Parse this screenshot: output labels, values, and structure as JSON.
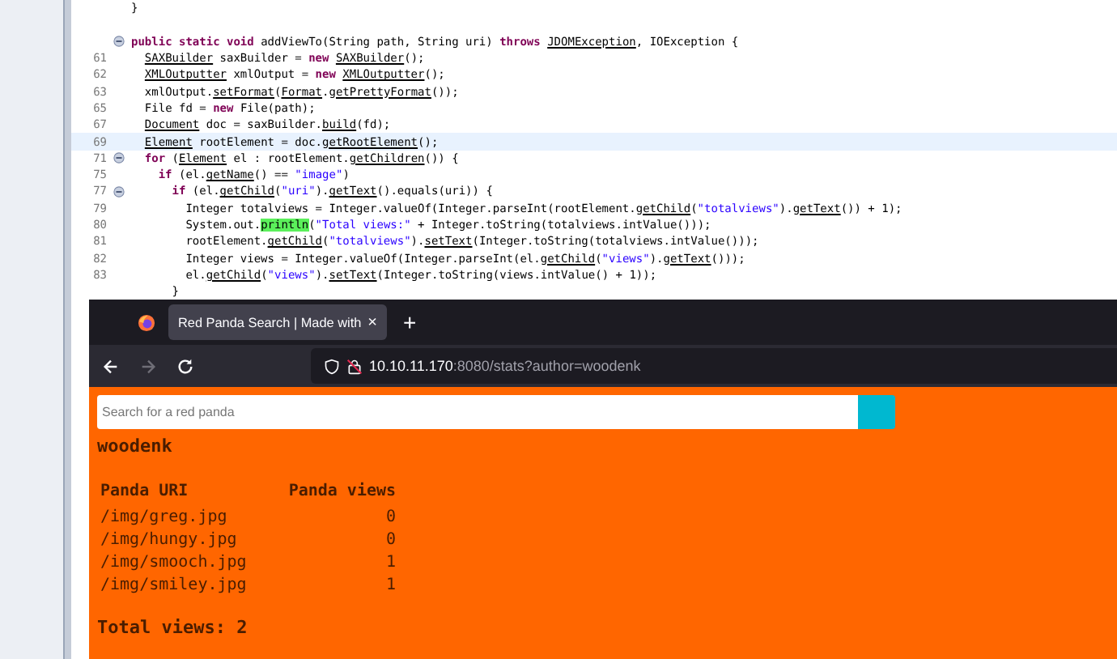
{
  "editor": {
    "lines": [
      {
        "tokens": [
          {
            "kind": "plain",
            "text": "}"
          }
        ]
      },
      {
        "fold": true,
        "blank_before": true,
        "tokens": [
          {
            "kind": "keyword",
            "text": "public static void"
          },
          {
            "kind": "plain",
            "text": " addViewTo(String path, String uri) "
          },
          {
            "kind": "keyword",
            "text": "throws "
          },
          {
            "kind": "ref",
            "text": "JDOMException"
          },
          {
            "kind": "plain",
            "text": ", IOException {"
          }
        ],
        "children": [
          {
            "number": "61",
            "tokens": [
              {
                "kind": "ref",
                "text": "SAXBuilder"
              },
              {
                "kind": "plain",
                "text": " saxBuilder = "
              },
              {
                "kind": "keyword",
                "text": "new "
              },
              {
                "kind": "ref",
                "text": "SAXBuilder"
              },
              {
                "kind": "plain",
                "text": "();"
              }
            ]
          },
          {
            "number": "62",
            "tokens": [
              {
                "kind": "ref",
                "text": "XMLOutputter"
              },
              {
                "kind": "plain",
                "text": " xmlOutput = "
              },
              {
                "kind": "keyword",
                "text": "new "
              },
              {
                "kind": "ref",
                "text": "XMLOutputter"
              },
              {
                "kind": "plain",
                "text": "();"
              }
            ]
          },
          {
            "number": "63",
            "tokens": [
              {
                "kind": "plain",
                "text": "xmlOutput."
              },
              {
                "kind": "ref",
                "text": "setFormat"
              },
              {
                "kind": "plain",
                "text": "("
              },
              {
                "kind": "ref",
                "text": "Format"
              },
              {
                "kind": "plain",
                "text": "."
              },
              {
                "kind": "ref",
                "text": "getPrettyFormat"
              },
              {
                "kind": "plain",
                "text": "());"
              }
            ]
          },
          {
            "number": "65",
            "tokens": [
              {
                "kind": "plain",
                "text": "File fd = "
              },
              {
                "kind": "keyword",
                "text": "new"
              },
              {
                "kind": "plain",
                "text": " File(path);"
              }
            ]
          },
          {
            "number": "67",
            "tokens": [
              {
                "kind": "ref",
                "text": "Document"
              },
              {
                "kind": "plain",
                "text": " doc = saxBuilder."
              },
              {
                "kind": "ref",
                "text": "build"
              },
              {
                "kind": "plain",
                "text": "(fd);"
              }
            ]
          },
          {
            "number": "69",
            "current": true,
            "tokens": [
              {
                "kind": "ref",
                "text": "Element"
              },
              {
                "kind": "plain",
                "text": " rootElement = doc."
              },
              {
                "kind": "ref",
                "text": "getRootElement"
              },
              {
                "kind": "plain",
                "text": "();"
              }
            ]
          },
          {
            "number": "71",
            "fold": true,
            "tokens": [
              {
                "kind": "keyword",
                "text": "for"
              },
              {
                "kind": "plain",
                "text": " ("
              },
              {
                "kind": "ref",
                "text": "Element"
              },
              {
                "kind": "plain",
                "text": " el : rootElement."
              },
              {
                "kind": "ref",
                "text": "getChildren"
              },
              {
                "kind": "plain",
                "text": "()) {"
              }
            ],
            "children": [
              {
                "number": "75",
                "tokens": [
                  {
                    "kind": "keyword",
                    "text": "if"
                  },
                  {
                    "kind": "plain",
                    "text": " (el."
                  },
                  {
                    "kind": "ref",
                    "text": "getName"
                  },
                  {
                    "kind": "plain",
                    "text": "() == "
                  },
                  {
                    "kind": "string",
                    "text": "\"image\""
                  },
                  {
                    "kind": "plain",
                    "text": ")"
                  }
                ],
                "children": [
                  {
                    "number": "77",
                    "fold": true,
                    "tokens": [
                      {
                        "kind": "keyword",
                        "text": "if"
                      },
                      {
                        "kind": "plain",
                        "text": " (el."
                      },
                      {
                        "kind": "ref",
                        "text": "getChild"
                      },
                      {
                        "kind": "plain",
                        "text": "("
                      },
                      {
                        "kind": "string",
                        "text": "\"uri\""
                      },
                      {
                        "kind": "plain",
                        "text": ")."
                      },
                      {
                        "kind": "ref",
                        "text": "getText"
                      },
                      {
                        "kind": "plain",
                        "text": "().equals(uri)) {"
                      }
                    ],
                    "children": [
                      {
                        "number": "79",
                        "tokens": [
                          {
                            "kind": "plain",
                            "text": "Integer totalviews = Integer.valueOf(Integer.parseInt(rootElement."
                          },
                          {
                            "kind": "ref",
                            "text": "getChild"
                          },
                          {
                            "kind": "plain",
                            "text": "("
                          },
                          {
                            "kind": "string",
                            "text": "\"totalviews\""
                          },
                          {
                            "kind": "plain",
                            "text": ")."
                          },
                          {
                            "kind": "ref",
                            "text": "getText"
                          },
                          {
                            "kind": "plain",
                            "text": "()) + 1);"
                          }
                        ]
                      },
                      {
                        "number": "80",
                        "tokens": [
                          {
                            "kind": "plain",
                            "text": "System.out."
                          },
                          {
                            "kind": "match",
                            "text": "println"
                          },
                          {
                            "kind": "plain",
                            "text": "("
                          },
                          {
                            "kind": "string",
                            "text": "\"Total views:\""
                          },
                          {
                            "kind": "plain",
                            "text": " + Integer.toString(totalviews.intValue()));"
                          }
                        ]
                      },
                      {
                        "number": "81",
                        "tokens": [
                          {
                            "kind": "plain",
                            "text": "rootElement."
                          },
                          {
                            "kind": "ref",
                            "text": "getChild"
                          },
                          {
                            "kind": "plain",
                            "text": "("
                          },
                          {
                            "kind": "string",
                            "text": "\"totalviews\""
                          },
                          {
                            "kind": "plain",
                            "text": ")."
                          },
                          {
                            "kind": "ref",
                            "text": "setText"
                          },
                          {
                            "kind": "plain",
                            "text": "(Integer.toString(totalviews.intValue()));"
                          }
                        ]
                      },
                      {
                        "number": "82",
                        "tokens": [
                          {
                            "kind": "plain",
                            "text": "Integer views = Integer.valueOf(Integer.parseInt(el."
                          },
                          {
                            "kind": "ref",
                            "text": "getChild"
                          },
                          {
                            "kind": "plain",
                            "text": "("
                          },
                          {
                            "kind": "string",
                            "text": "\"views\""
                          },
                          {
                            "kind": "plain",
                            "text": ")."
                          },
                          {
                            "kind": "ref",
                            "text": "getText"
                          },
                          {
                            "kind": "plain",
                            "text": "()));"
                          }
                        ]
                      },
                      {
                        "number": "83",
                        "tokens": [
                          {
                            "kind": "plain",
                            "text": "el."
                          },
                          {
                            "kind": "ref",
                            "text": "getChild"
                          },
                          {
                            "kind": "plain",
                            "text": "("
                          },
                          {
                            "kind": "string",
                            "text": "\"views\""
                          },
                          {
                            "kind": "plain",
                            "text": ")."
                          },
                          {
                            "kind": "ref",
                            "text": "setText"
                          },
                          {
                            "kind": "plain",
                            "text": "(Integer.toString(views.intValue() + 1));"
                          }
                        ]
                      }
                    ]
                  },
                  {
                    "tokens": [
                      {
                        "kind": "plain",
                        "text": "}"
                      }
                    ]
                  }
                ]
              }
            ]
          }
        ]
      }
    ]
  },
  "browser": {
    "tabs": [
      {
        "title": "Red Panda Search | Made with",
        "close": "×",
        "selected": true
      }
    ],
    "new_tab": "+",
    "address": {
      "host": "10.10.11.170",
      "rest": ":8080/stats?author=woodenk"
    },
    "page": {
      "search": {
        "placeholder": "Search for a red panda"
      },
      "author": "woodenk",
      "table": {
        "columns": [
          "Panda URI",
          "Panda views"
        ],
        "rows": [
          [
            "/img/greg.jpg",
            "0"
          ],
          [
            "/img/hungy.jpg",
            "0"
          ],
          [
            "/img/smooch.jpg",
            "1"
          ],
          [
            "/img/smiley.jpg",
            "1"
          ]
        ]
      },
      "total": "Total views: 2"
    }
  }
}
